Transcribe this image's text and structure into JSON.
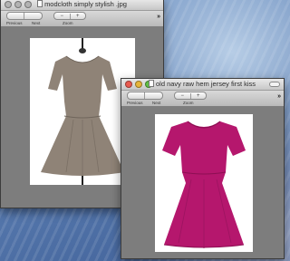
{
  "window_back": {
    "title": "modcloth simply stylish .jpg",
    "toolbar": {
      "previous_label": "Previous",
      "next_label": "Next",
      "zoom_label": "Zoom",
      "zoom_out_icon": "−",
      "zoom_in_icon": "+",
      "overflow_icon": "»"
    }
  },
  "window_front": {
    "title": "old navy raw hem jersey first kiss",
    "toolbar": {
      "previous_label": "Previous",
      "next_label": "Next",
      "zoom_label": "Zoom",
      "zoom_out_icon": "−",
      "zoom_in_icon": "+",
      "overflow_icon": "»"
    }
  },
  "colors": {
    "grey_dress": "#8f8377",
    "magenta_dress": "#b5176d",
    "close": "#e95a4f",
    "minimize": "#e6b53a",
    "zoom": "#62c045"
  },
  "icons": [
    "dress-grey-image",
    "dress-magenta-image",
    "chevron-double-right-icon",
    "zoom-in-icon",
    "zoom-out-icon"
  ]
}
